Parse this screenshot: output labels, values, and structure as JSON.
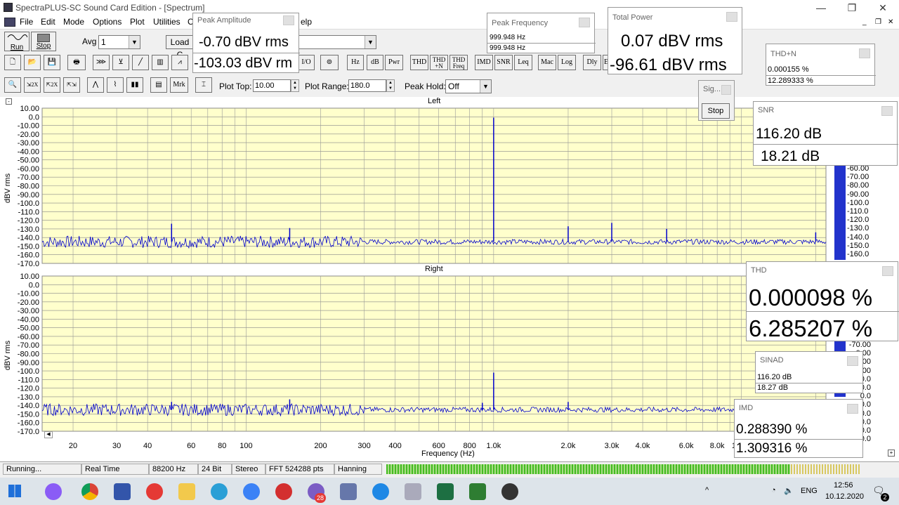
{
  "window": {
    "title": "SpectraPLUS-SC Sound Card Edition - [Spectrum]",
    "minimize": "—",
    "restore": "❐",
    "close": "✕"
  },
  "menu": {
    "items": [
      "File",
      "Edit",
      "Mode",
      "Options",
      "Plot",
      "Utilities",
      "C",
      "elp"
    ]
  },
  "toolbar": {
    "run_label": "Run",
    "stop_label": "Stop",
    "avg_label": "Avg",
    "avg_value": "1",
    "load_label": "Load C",
    "buttons": [
      "I/O",
      "Hz",
      "dB",
      "Pwr",
      "THD",
      "THD +N",
      "THD Freq",
      "IMD",
      "SNR",
      "Leq",
      "Mac",
      "Log",
      "Dly",
      "E"
    ],
    "row3_buttons": [
      "Mrk"
    ],
    "plot_top_label": "Plot Top:",
    "plot_top_value": "10.00",
    "plot_range_label": "Plot Range:",
    "plot_range_value": "180.0",
    "peak_hold_label": "Peak Hold:",
    "peak_hold_value": "Off"
  },
  "plots": {
    "left_title": "Left",
    "right_title": "Right",
    "ylabel": "dBV rms",
    "xlabel": "Frequency (Hz)",
    "yticks": [
      "10.00",
      "0.0",
      "-10.00",
      "-20.00",
      "-30.00",
      "-40.00",
      "-50.00",
      "-60.00",
      "-70.00",
      "-80.00",
      "-90.00",
      "-100.0",
      "-110.0",
      "-120.0",
      "-130.0",
      "-140.0",
      "-150.0",
      "-160.0",
      "-170.0"
    ],
    "xticks": [
      "20",
      "30",
      "40",
      "60",
      "80",
      "100",
      "200",
      "300",
      "400",
      "600",
      "800",
      "1.0k",
      "2.0k",
      "3.0k",
      "4.0k",
      "6.0k",
      "8.0k",
      "10.0k"
    ],
    "xtick_freqs": [
      20,
      30,
      40,
      60,
      80,
      100,
      200,
      300,
      400,
      600,
      800,
      1000,
      2000,
      3000,
      4000,
      6000,
      8000,
      10000
    ],
    "right_partial_ticks_top": [
      "-60.00",
      "-70.00",
      "-80.00",
      "-90.00",
      "-100.0",
      "-110.0",
      "-120.0",
      "-130.0",
      "-140.0",
      "-150.0",
      "-160.0"
    ],
    "right_partial_ticks_bottom": [
      "-70.00",
      "0.00",
      "0.00",
      "0.00",
      "0.0",
      "0.0",
      "0.0",
      "-130.0",
      "0.0",
      "0.0",
      "0.0",
      "0.0"
    ],
    "plot_color": "#ffffcc",
    "trace_color": "#0000cc"
  },
  "chart_data": [
    {
      "type": "line",
      "title": "Left",
      "xlabel": "Frequency (Hz)",
      "ylabel": "dBV rms",
      "xscale": "log",
      "ylim": [
        -170,
        10
      ],
      "noise_floor": -145,
      "peaks": [
        {
          "x": 50,
          "y": -124
        },
        {
          "x": 150,
          "y": -129
        },
        {
          "x": 1000,
          "y": -1
        },
        {
          "x": 2000,
          "y": -127
        },
        {
          "x": 3000,
          "y": -123
        },
        {
          "x": 5000,
          "y": -130
        },
        {
          "x": 20000,
          "y": -134
        }
      ]
    },
    {
      "type": "line",
      "title": "Right",
      "xlabel": "Frequency (Hz)",
      "ylabel": "dBV rms",
      "xscale": "log",
      "ylim": [
        -170,
        10
      ],
      "noise_floor": -145,
      "peaks": [
        {
          "x": 50,
          "y": -136
        },
        {
          "x": 150,
          "y": -133
        },
        {
          "x": 900,
          "y": -137
        },
        {
          "x": 1000,
          "y": -102
        },
        {
          "x": 2000,
          "y": -136
        }
      ]
    }
  ],
  "meters": {
    "peak_amplitude": {
      "caption": "Peak Amplitude",
      "v1": "-0.70 dBV rms",
      "v2": "-103.03 dBV rm"
    },
    "peak_frequency": {
      "caption": "Peak Frequency",
      "v1": "999.948 Hz",
      "v2": "999.948 Hz"
    },
    "total_power": {
      "caption": "Total Power",
      "v1": "0.07 dBV rms",
      "v2": "-96.61 dBV rms"
    },
    "thd_n": {
      "caption": "THD+N",
      "v1": "0.000155 %",
      "v2": "12.289333 %"
    },
    "signal": {
      "caption": "Sig...",
      "button": "Stop"
    },
    "snr": {
      "caption": "SNR",
      "v1": "116.20 dB",
      "v2": "18.21 dB"
    },
    "thd": {
      "caption": "THD",
      "v1": "0.000098 %",
      "v2": "6.285207 %"
    },
    "sinad": {
      "caption": "SINAD",
      "v1": "116.20 dB",
      "v2": "18.27 dB"
    },
    "imd": {
      "caption": "IMD",
      "v1": "0.288390 %",
      "v2": "1.309316 %"
    }
  },
  "status": {
    "state": "Running...",
    "mode": "Real Time",
    "rate": "88200 Hz",
    "bits": "24 Bit",
    "channels": "Stereo",
    "fft": "FFT 524288 pts",
    "window": "Hanning",
    "level_fraction": 0.85
  },
  "taskbar": {
    "lang": "ENG",
    "time": "12:56",
    "date": "10.12.2020",
    "badge": "28",
    "notif": "2"
  }
}
